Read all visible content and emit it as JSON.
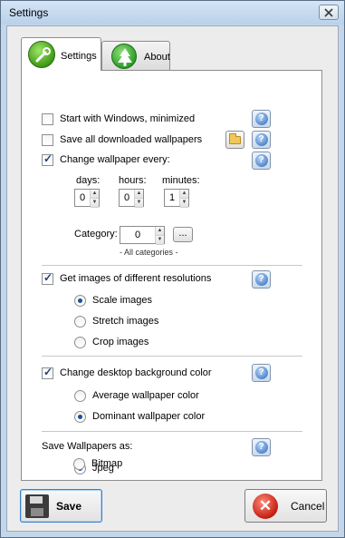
{
  "window": {
    "title": "Settings"
  },
  "tabs": [
    {
      "label": "Settings",
      "icon": "wrench-icon",
      "selected": true
    },
    {
      "label": "About",
      "icon": "tree-icon",
      "selected": false
    }
  ],
  "options": {
    "start_with_windows": {
      "label": "Start with Windows, minimized",
      "checked": false
    },
    "save_downloaded": {
      "label": "Save all downloaded wallpapers",
      "checked": false
    },
    "change_wallpaper": {
      "label": "Change wallpaper every:",
      "checked": true
    }
  },
  "interval": {
    "days_label": "days:",
    "days_value": "0",
    "hours_label": "hours:",
    "hours_value": "0",
    "minutes_label": "minutes:",
    "minutes_value": "1"
  },
  "category": {
    "label": "Category:",
    "value": "0",
    "browse_label": "...",
    "caption": "- All categories -"
  },
  "resolutions": {
    "label": "Get images of different resolutions",
    "checked": true,
    "options": [
      {
        "label": "Scale images",
        "selected": true
      },
      {
        "label": "Stretch images",
        "selected": false
      },
      {
        "label": "Crop images",
        "selected": false
      }
    ]
  },
  "bgcolor": {
    "label": "Change desktop background color",
    "checked": true,
    "options": [
      {
        "label": "Average wallpaper color",
        "selected": false
      },
      {
        "label": "Dominant wallpaper color",
        "selected": true
      }
    ]
  },
  "save_as": {
    "label": "Save Wallpapers as:",
    "options": [
      {
        "label": "Jpeg",
        "selected": true
      },
      {
        "label": "Bitmap",
        "selected": false
      }
    ]
  },
  "buttons": {
    "save": "Save",
    "cancel": "Cancel"
  },
  "help_glyph": "?"
}
